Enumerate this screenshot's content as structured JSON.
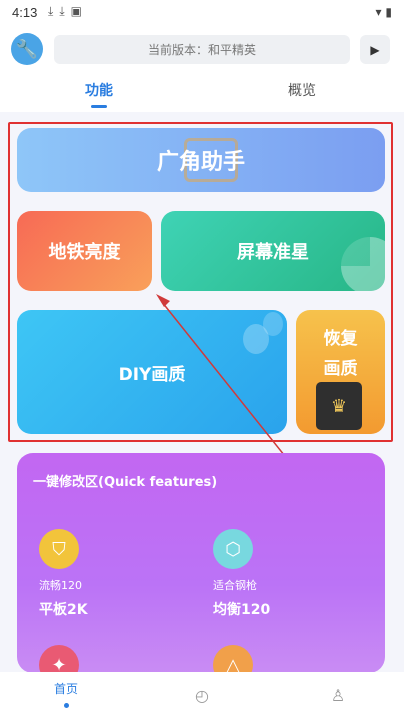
{
  "status_bar": {
    "time": "4:13",
    "notification_icons": [
      "download-icon",
      "download-icon",
      "image-icon"
    ],
    "system_icons": [
      "wifi-icon",
      "battery-icon"
    ]
  },
  "header": {
    "app_icon": "wrench-icon",
    "version_text": "当前版本：和平精英",
    "play_icon": "play-icon"
  },
  "tabs": [
    {
      "label": "功能",
      "active": true
    },
    {
      "label": "概览",
      "active": false
    }
  ],
  "cards": {
    "wide_angle": "广角助手",
    "metro_brightness": "地铁亮度",
    "crosshair": "屏幕准星",
    "diy_quality": "DIY画质",
    "restore_quality": "恢复画质"
  },
  "quick_features": {
    "title": "一键修改区(Quick features)",
    "items": [
      {
        "sub": "流畅120",
        "main": "平板2K",
        "icon": "shield-icon"
      },
      {
        "sub": "适合钢枪",
        "main": "均衡120",
        "icon": "hexagon-icon"
      },
      {
        "sub": "",
        "main": "",
        "icon": "star-icon"
      },
      {
        "sub": "",
        "main": "",
        "icon": "triangle-icon"
      }
    ]
  },
  "bottom_nav": [
    {
      "label": "首页",
      "icon": "home-icon",
      "active": true
    },
    {
      "label": "",
      "icon": "compass-icon",
      "active": false
    },
    {
      "label": "",
      "icon": "user-icon",
      "active": false
    }
  ],
  "colors": {
    "accent": "#2a7de0",
    "highlight_box": "#e03131",
    "quick_panel": "#c267f2"
  }
}
